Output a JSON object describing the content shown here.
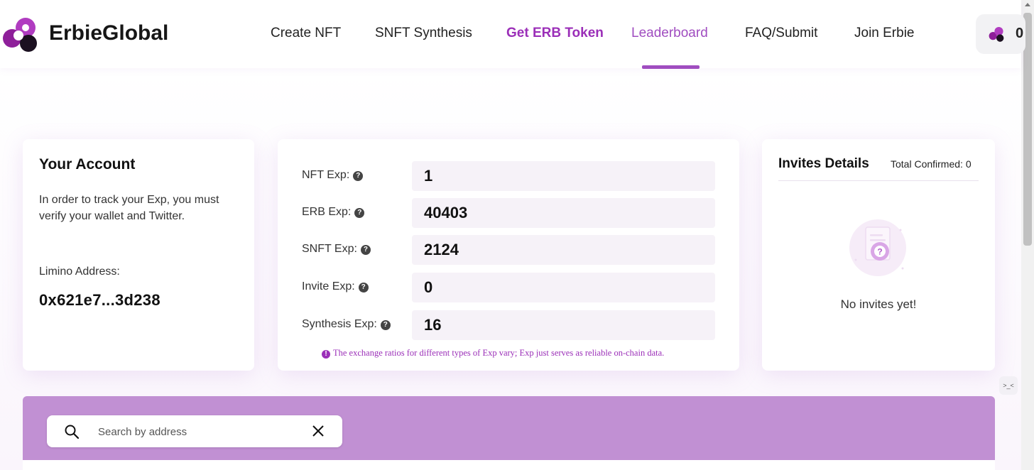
{
  "header": {
    "brand": "ErbieGlobal",
    "nav": [
      {
        "label": "Create NFT"
      },
      {
        "label": "SNFT Synthesis"
      },
      {
        "label": "Get ERB Token"
      },
      {
        "label": "Leaderboard"
      },
      {
        "label": "FAQ/Submit"
      },
      {
        "label": "Join Erbie"
      }
    ],
    "active_nav": "Leaderboard",
    "wallet_chip_text": "0",
    "brand_color": "#9b2fb8"
  },
  "account": {
    "title": "Your Account",
    "description": "In order to track your Exp, you must verify your wallet and Twitter.",
    "address_label": "Limino Address:",
    "address": "0x621e7...3d238"
  },
  "exp": {
    "rows": [
      {
        "label": "NFT Exp:",
        "value": "1"
      },
      {
        "label": "ERB Exp:",
        "value": "40403"
      },
      {
        "label": "SNFT Exp:",
        "value": "2124"
      },
      {
        "label": "Invite Exp:",
        "value": "0"
      },
      {
        "label": "Synthesis Exp:",
        "value": "16"
      }
    ],
    "note": "The exchange ratios for different types of Exp vary; Exp just serves as reliable on-chain data."
  },
  "invites": {
    "title": "Invites Details",
    "total": "Total Confirmed: 0",
    "empty_text": "No invites yet!"
  },
  "leaderboard": {
    "search_placeholder": "Search by address",
    "accent_color": "#c190d3"
  },
  "icons": [
    "erbie-logo-icon",
    "help-icon",
    "info-icon",
    "empty-document-icon",
    "search-icon",
    "close-icon"
  ]
}
